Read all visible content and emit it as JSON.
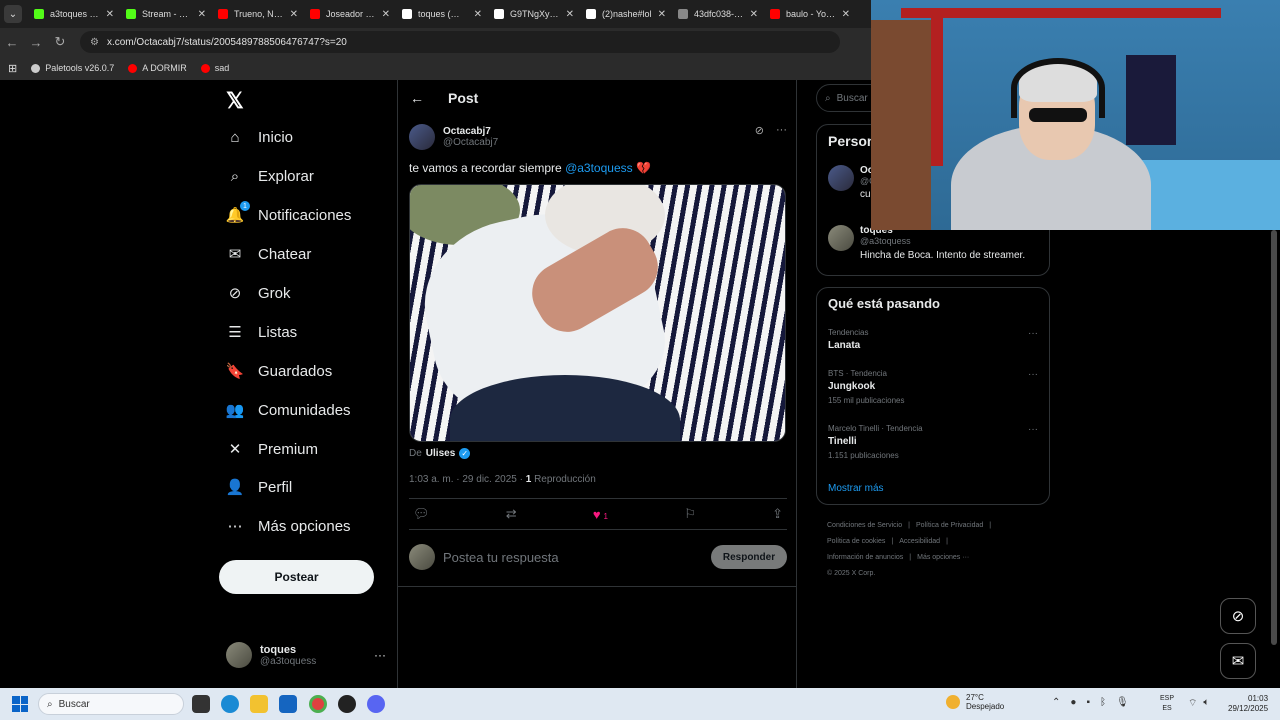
{
  "browser": {
    "tabs": [
      {
        "label": "a3toques Str",
        "color": "#53fc18"
      },
      {
        "label": "Stream - Kick",
        "color": "#53fc18"
      },
      {
        "label": "Trueno, Nick",
        "color": "#ff0000"
      },
      {
        "label": "Joseador Boj",
        "color": "#ff0000"
      },
      {
        "label": "toques (@a3",
        "color": "#ffffff"
      },
      {
        "label": "G9TNgXyX0",
        "color": "#ffffff"
      },
      {
        "label": "(2)nashe#lol",
        "color": "#ffffff"
      },
      {
        "label": "43dfc038-b5",
        "color": "#888888"
      },
      {
        "label": "baulo - YouT",
        "color": "#ff0000"
      }
    ],
    "url": "x.com/Octacabj7/status/2005489788506476747?s=20",
    "bookmarks": [
      {
        "label": "Paletools v26.0.7",
        "color": "#cccccc"
      },
      {
        "label": "A DORMIR",
        "color": "#ff0000"
      },
      {
        "label": "sad",
        "color": "#ff0000"
      }
    ]
  },
  "nav": {
    "items": [
      {
        "label": "Inicio",
        "icon": "home-icon",
        "glyph": "⌂"
      },
      {
        "label": "Explorar",
        "icon": "search-icon",
        "glyph": "⌕"
      },
      {
        "label": "Notificaciones",
        "icon": "bell-icon",
        "glyph": "🔔",
        "badge": "1"
      },
      {
        "label": "Chatear",
        "icon": "mail-icon",
        "glyph": "✉"
      },
      {
        "label": "Grok",
        "icon": "grok-icon",
        "glyph": "⊘"
      },
      {
        "label": "Listas",
        "icon": "list-icon",
        "glyph": "☰"
      },
      {
        "label": "Guardados",
        "icon": "bookmark-icon",
        "glyph": "🔖"
      },
      {
        "label": "Comunidades",
        "icon": "communities-icon",
        "glyph": "👥"
      },
      {
        "label": "Premium",
        "icon": "x-icon",
        "glyph": "✕"
      },
      {
        "label": "Perfil",
        "icon": "person-icon",
        "glyph": "👤"
      },
      {
        "label": "Más opciones",
        "icon": "more-circle-icon",
        "glyph": "⋯"
      }
    ],
    "post_button": "Postear",
    "account": {
      "name": "toques",
      "handle": "@a3toquess"
    }
  },
  "main": {
    "header": "Post",
    "tweet": {
      "author_name": "Octacabj7",
      "author_handle": "@Octacabj7",
      "text_before": "te vamos a recordar siempre ",
      "mention": "@a3toquess",
      "emoji": "💔",
      "byline_prefix": "De",
      "byline_name": "Ulises",
      "time": "1:03 a. m. · 29 dic. 2025 · ",
      "views_count": "1",
      "views_label": " Reproducción",
      "likes": "1"
    },
    "reply_placeholder": "Postea tu respuesta",
    "reply_button": "Responder"
  },
  "right": {
    "search_placeholder": "Buscar",
    "people_title": "Person",
    "people": [
      {
        "name": "Oc",
        "handle": "@O",
        "bio": "cu"
      },
      {
        "name": "toques",
        "handle": "@a3toquess",
        "bio": "Hincha de Boca. Intento de streamer."
      }
    ],
    "trends_title": "Qué está pasando",
    "trends": [
      {
        "context": "Tendencias",
        "title": "Lanata",
        "count": ""
      },
      {
        "context": "BTS · Tendencia",
        "title": "Jungkook",
        "count": "155 mil publicaciones"
      },
      {
        "context": "Marcelo Tinelli · Tendencia",
        "title": "Tinelli",
        "count": "1.151 publicaciones"
      }
    ],
    "show_more": "Mostrar más",
    "footer": [
      "Condiciones de Servicio",
      "|",
      "Política de Privacidad",
      "|",
      "Política de cookies",
      "|",
      "Accesibilidad",
      "|",
      "Información de anuncios",
      "|",
      "Más opciones ···",
      "© 2025 X Corp."
    ]
  },
  "taskbar": {
    "search": "Buscar",
    "weather_temp": "27°C",
    "weather_desc": "Despejado",
    "lang_top": "ESP",
    "lang_bottom": "ES",
    "time": "01:03",
    "date": "29/12/2025"
  }
}
